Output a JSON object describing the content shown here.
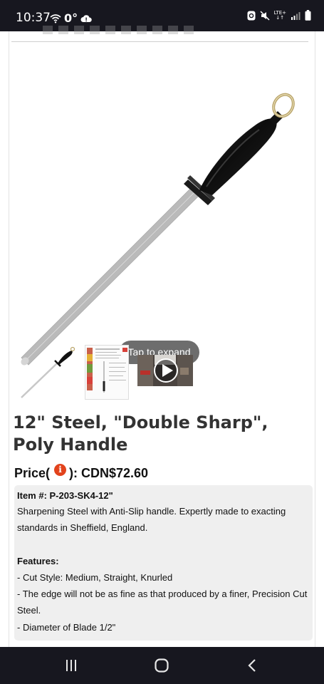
{
  "status_bar": {
    "time": "10:37",
    "temperature": "0°",
    "lte_label": "LTE+"
  },
  "gallery": {
    "expand_label": "Tap to expand"
  },
  "product": {
    "title": "12\" Steel, \"Double Sharp\", Poly Handle",
    "price_prefix": "Price(",
    "info_icon_glyph": "i",
    "price_suffix": "): CDN$72.60"
  },
  "description": {
    "item_number": "Item #: P-203-SK4-12\"",
    "summary": "Sharpening Steel with Anti-Slip handle. Expertly made to exacting standards in Sheffield, England.",
    "features_heading": "Features:",
    "features": [
      "- Cut Style: Medium, Straight, Knurled",
      "- The edge will not be as fine as that produced by a finer, Precision Cut Steel.",
      "- Diameter of Blade 1/2\""
    ]
  },
  "colors": {
    "status_bar_bg": "#17171f",
    "pill_bg": "#6d6d6d",
    "desc_bg": "#efefef",
    "info_badge": "#e2431c"
  },
  "icons": {
    "status": [
      "wifi-icon",
      "cloud-alert-icon",
      "app-notification-icon",
      "mute-icon",
      "signal-icon",
      "battery-icon"
    ],
    "nav": [
      "recents-icon",
      "home-icon",
      "back-icon"
    ]
  }
}
